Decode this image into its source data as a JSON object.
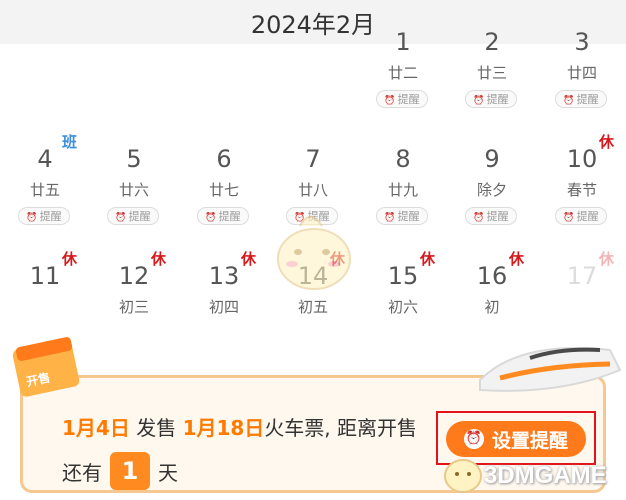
{
  "header": {
    "month": "2024年2月"
  },
  "remind_label": "提醒",
  "days": [
    {
      "day": "1",
      "lunar": "廿二",
      "badge": "",
      "remind": true
    },
    {
      "day": "2",
      "lunar": "廿三",
      "badge": "",
      "remind": true
    },
    {
      "day": "3",
      "lunar": "廿四",
      "badge": "",
      "remind": true
    },
    {
      "day": "4",
      "lunar": "廿五",
      "badge": "班",
      "remind": true
    },
    {
      "day": "5",
      "lunar": "廿六",
      "badge": "",
      "remind": true
    },
    {
      "day": "6",
      "lunar": "廿七",
      "badge": "",
      "remind": true
    },
    {
      "day": "7",
      "lunar": "廿八",
      "badge": "",
      "remind": true
    },
    {
      "day": "8",
      "lunar": "廿九",
      "badge": "",
      "remind": true
    },
    {
      "day": "9",
      "lunar": "除夕",
      "badge": "",
      "remind": true
    },
    {
      "day": "10",
      "lunar": "春节",
      "badge": "休",
      "remind": true
    },
    {
      "day": "11",
      "lunar": "",
      "badge": "休",
      "remind": false
    },
    {
      "day": "12",
      "lunar": "初三",
      "badge": "休",
      "remind": false
    },
    {
      "day": "13",
      "lunar": "初四",
      "badge": "休",
      "remind": false
    },
    {
      "day": "14",
      "lunar": "初五",
      "badge": "休",
      "remind": false
    },
    {
      "day": "15",
      "lunar": "初六",
      "badge": "休",
      "remind": false
    },
    {
      "day": "16",
      "lunar": "初",
      "badge": "休",
      "remind": false
    },
    {
      "day": "17",
      "lunar": "",
      "badge": "休",
      "remind": false
    }
  ],
  "banner": {
    "date1": "1月4日",
    "text1": "发售",
    "date2": "1月18日",
    "text2": "火车票, 距离开售",
    "prefix": "还有",
    "count": "1",
    "suffix": "天",
    "button_label": "设置提醒",
    "sale_tag": "开售"
  },
  "watermark": "3DMGAME",
  "colors": {
    "accent": "#ff7a1a",
    "rest": "#d6191c",
    "work": "#3d8fdc",
    "highlight_border": "#e0141a"
  }
}
